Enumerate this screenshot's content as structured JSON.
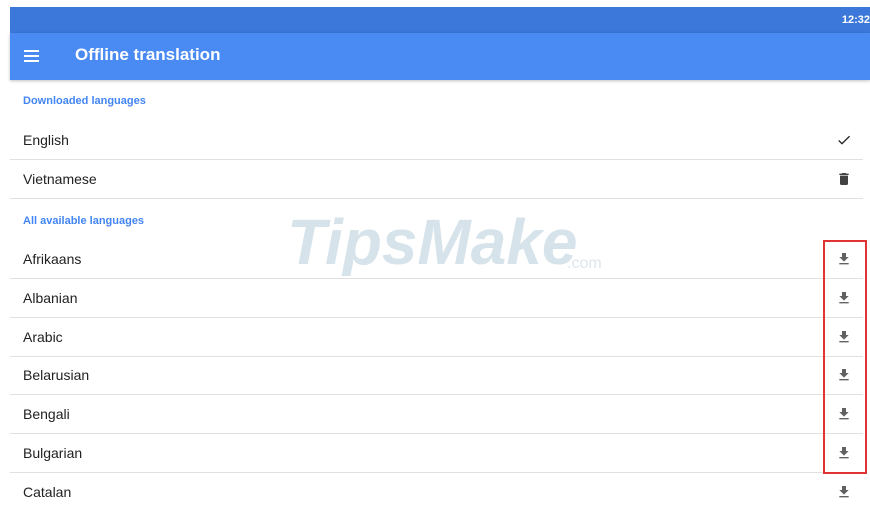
{
  "status_bar": {
    "time": "12:32"
  },
  "app_bar": {
    "title": "Offline translation",
    "menu_icon": "menu-icon"
  },
  "downloaded": {
    "header": "Downloaded languages",
    "items": [
      {
        "label": "English",
        "icon": "check-icon"
      },
      {
        "label": "Vietnamese",
        "icon": "delete-icon"
      }
    ]
  },
  "available": {
    "header": "All available languages",
    "items": [
      {
        "label": "Afrikaans",
        "icon": "download-icon"
      },
      {
        "label": "Albanian",
        "icon": "download-icon"
      },
      {
        "label": "Arabic",
        "icon": "download-icon"
      },
      {
        "label": "Belarusian",
        "icon": "download-icon"
      },
      {
        "label": "Bengali",
        "icon": "download-icon"
      },
      {
        "label": "Bulgarian",
        "icon": "download-icon"
      },
      {
        "label": "Catalan",
        "icon": "download-icon"
      }
    ]
  },
  "watermark": {
    "main": "TipsMake",
    "suffix": ".com"
  },
  "colors": {
    "app_bar": "#4a8af3",
    "status_bar": "#3b78d9",
    "section_header": "#4285f4",
    "highlight": "#e03434"
  }
}
